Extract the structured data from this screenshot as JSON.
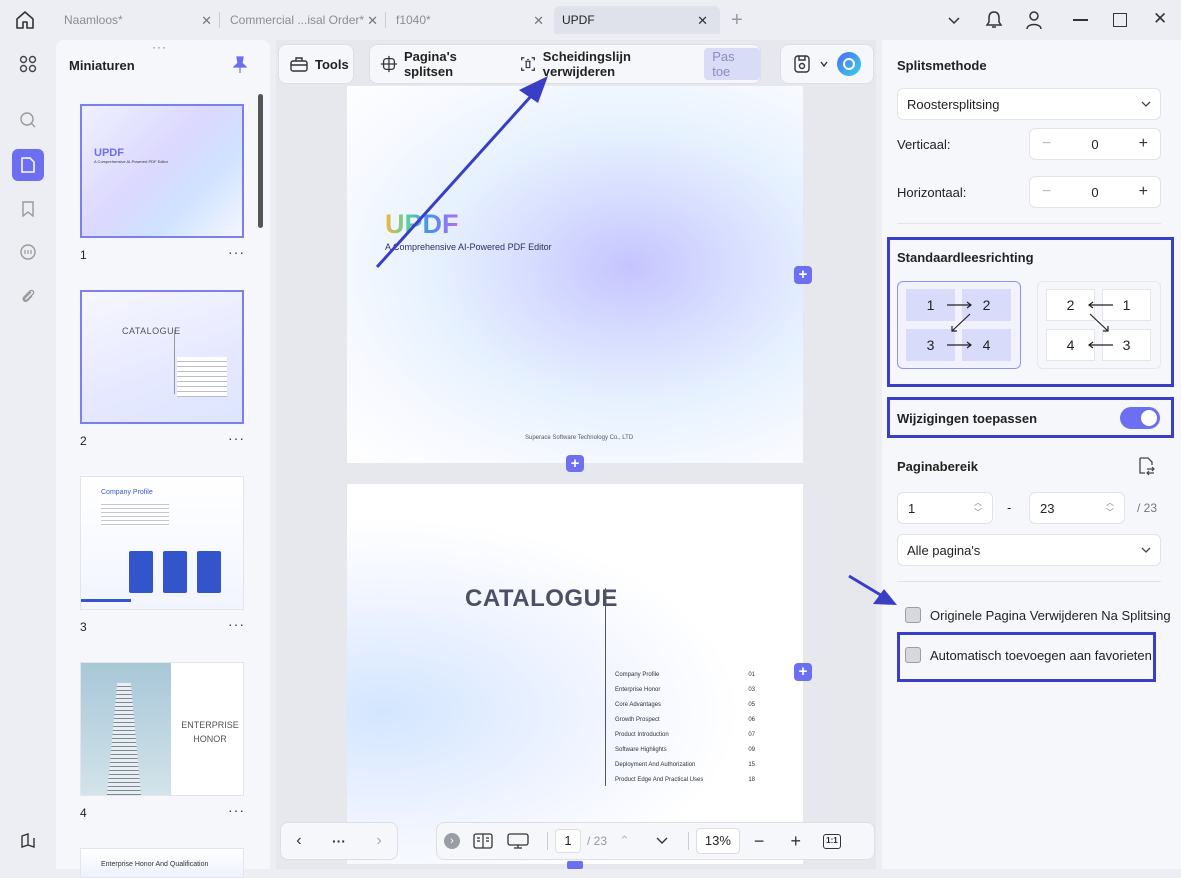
{
  "tabs": [
    {
      "label": "Naamloos*"
    },
    {
      "label": "Commercial ...isal Order*"
    },
    {
      "label": "f1040*"
    },
    {
      "label": "UPDF"
    }
  ],
  "thumbnails": {
    "title": "Miniaturen",
    "pages": [
      {
        "number": "1",
        "brand": "UPDF",
        "subtitle": "A Comprehensive AI-Powered PDF Editor"
      },
      {
        "number": "2",
        "heading": "CATALOGUE"
      },
      {
        "number": "3",
        "heading": "Company Profile"
      },
      {
        "number": "4",
        "heading": "ENTERPRISE HONOR"
      },
      {
        "number": "",
        "heading": "Enterprise Honor And Qualification"
      }
    ]
  },
  "toolbar": {
    "tools_label": "Tools",
    "split_label": "Pagina's splitsen",
    "remove_line_label": "Scheidingslijn verwijderen",
    "apply_label": "Pas toe"
  },
  "document": {
    "page1": {
      "brand": "UPDF",
      "subtitle": "A Comprehensive AI-Powered PDF Editor",
      "footer": "Superace Software Technology Co., LTD"
    },
    "page2": {
      "heading": "CATALOGUE",
      "toc": [
        {
          "title": "Company Profile",
          "page": "01"
        },
        {
          "title": "Enterprise Honor",
          "page": "03"
        },
        {
          "title": "Core Advantages",
          "page": "05"
        },
        {
          "title": "Growth Prospect",
          "page": "06"
        },
        {
          "title": "Product Introduction",
          "page": "07"
        },
        {
          "title": "Software Highlights",
          "page": "09"
        },
        {
          "title": "Deployment And Authorization",
          "page": "15"
        },
        {
          "title": "Product Edge And Practical Uses",
          "page": "18"
        }
      ]
    }
  },
  "navigation": {
    "current_page": "1",
    "total_pages": "/ 23",
    "zoom": "13%",
    "more": "···",
    "fit": "1:1"
  },
  "settings": {
    "split_method_title": "Splitsmethode",
    "split_method_value": "Roostersplitsing",
    "vertical_label": "Verticaal:",
    "vertical_value": "0",
    "horizontal_label": "Horizontaal:",
    "horizontal_value": "0",
    "reading_direction_title": "Standaardleesrichting",
    "ltr_cells": [
      "1",
      "2",
      "3",
      "4"
    ],
    "rtl_cells": [
      "2",
      "1",
      "4",
      "3"
    ],
    "apply_changes_label": "Wijzigingen toepassen",
    "apply_changes_on": true,
    "page_range_title": "Paginabereik",
    "range_from": "1",
    "range_sep": "-",
    "range_to": "23",
    "range_total": "/ 23",
    "pages_select": "Alle pagina's",
    "delete_original_label": "Originele Pagina Verwijderen Na Splitsing",
    "add_favorites_label": "Automatisch toevoegen aan favorieten"
  },
  "colors": {
    "accent": "#6b6ff0",
    "annotation": "#3a3ec4"
  }
}
